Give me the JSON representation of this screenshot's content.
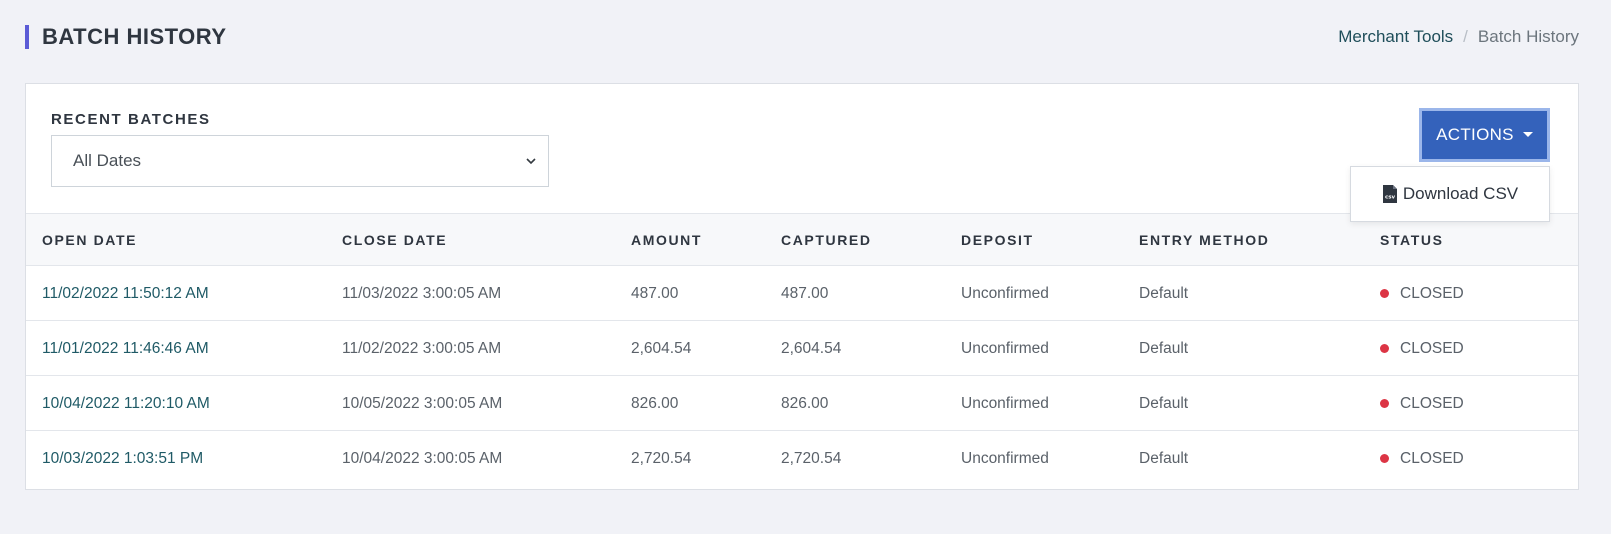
{
  "header": {
    "title": "BATCH HISTORY",
    "breadcrumb": {
      "parent": "Merchant Tools",
      "separator": "/",
      "current": "Batch History"
    }
  },
  "filter": {
    "label": "RECENT BATCHES",
    "selected": "All Dates"
  },
  "actions": {
    "label": "ACTIONS",
    "menu": {
      "download_csv": "Download CSV"
    }
  },
  "table": {
    "columns": [
      "OPEN DATE",
      "CLOSE DATE",
      "AMOUNT",
      "CAPTURED",
      "DEPOSIT",
      "ENTRY METHOD",
      "STATUS"
    ],
    "rows": [
      {
        "open": "11/02/2022 11:50:12 AM",
        "close": "11/03/2022 3:00:05 AM",
        "amount": "487.00",
        "captured": "487.00",
        "deposit": "Unconfirmed",
        "entry": "Default",
        "status": "CLOSED"
      },
      {
        "open": "11/01/2022 11:46:46 AM",
        "close": "11/02/2022 3:00:05 AM",
        "amount": "2,604.54",
        "captured": "2,604.54",
        "deposit": "Unconfirmed",
        "entry": "Default",
        "status": "CLOSED"
      },
      {
        "open": "10/04/2022 11:20:10 AM",
        "close": "10/05/2022 3:00:05 AM",
        "amount": "826.00",
        "captured": "826.00",
        "deposit": "Unconfirmed",
        "entry": "Default",
        "status": "CLOSED"
      },
      {
        "open": "10/03/2022 1:03:51 PM",
        "close": "10/04/2022 3:00:05 AM",
        "amount": "2,720.54",
        "captured": "2,720.54",
        "deposit": "Unconfirmed",
        "entry": "Default",
        "status": "CLOSED"
      }
    ]
  },
  "colors": {
    "accent_bar": "#5b5bd6",
    "primary_button": "#3462bb",
    "status_closed": "#dc3545",
    "link": "#1f5a66"
  },
  "icons": {
    "select_chevron": "chevron-down-icon",
    "csv": "csv-file-icon",
    "status": "status-dot-icon"
  }
}
